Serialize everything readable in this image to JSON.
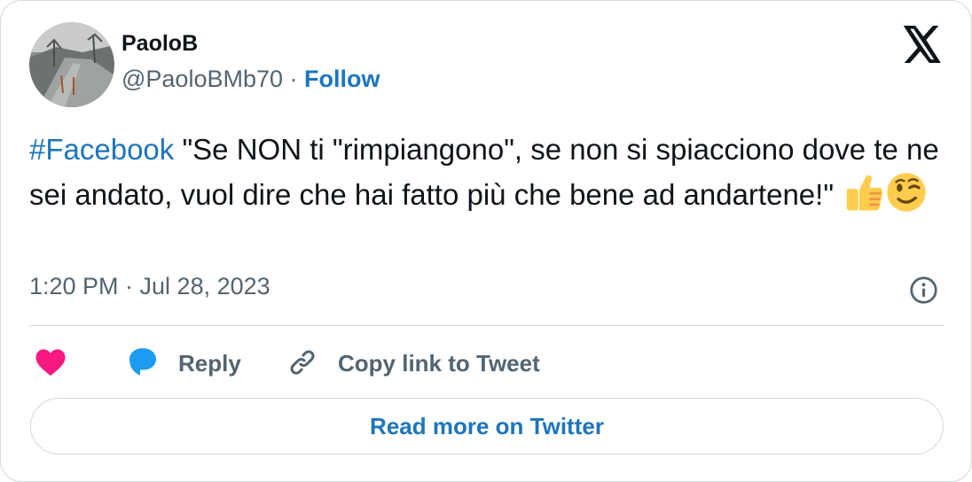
{
  "author": {
    "name": "PaoloB",
    "handle": "@PaoloBMb70",
    "separator": " · ",
    "follow_label": "Follow"
  },
  "tweet": {
    "hashtag": "#Facebook",
    "text": " \"Se NON ti \"rimpiangono\", se non si spiacciono  dove te ne sei andato, vuol dire che hai fatto più che bene ad andartene!\" ",
    "emojis": [
      "thumbs-up-emoji",
      "winking-face-emoji"
    ],
    "timestamp": "1:20 PM · Jul 28, 2023"
  },
  "actions": {
    "like_icon": "heart-icon",
    "reply_label": "Reply",
    "copy_link_label": "Copy link to Tweet"
  },
  "footer": {
    "read_more_label": "Read more on Twitter"
  },
  "colors": {
    "link_blue": "#1d75bd",
    "heart_pink": "#f91880",
    "reply_blue": "#1d9bf0",
    "muted_gray": "#536471",
    "border": "#cfd9de"
  }
}
